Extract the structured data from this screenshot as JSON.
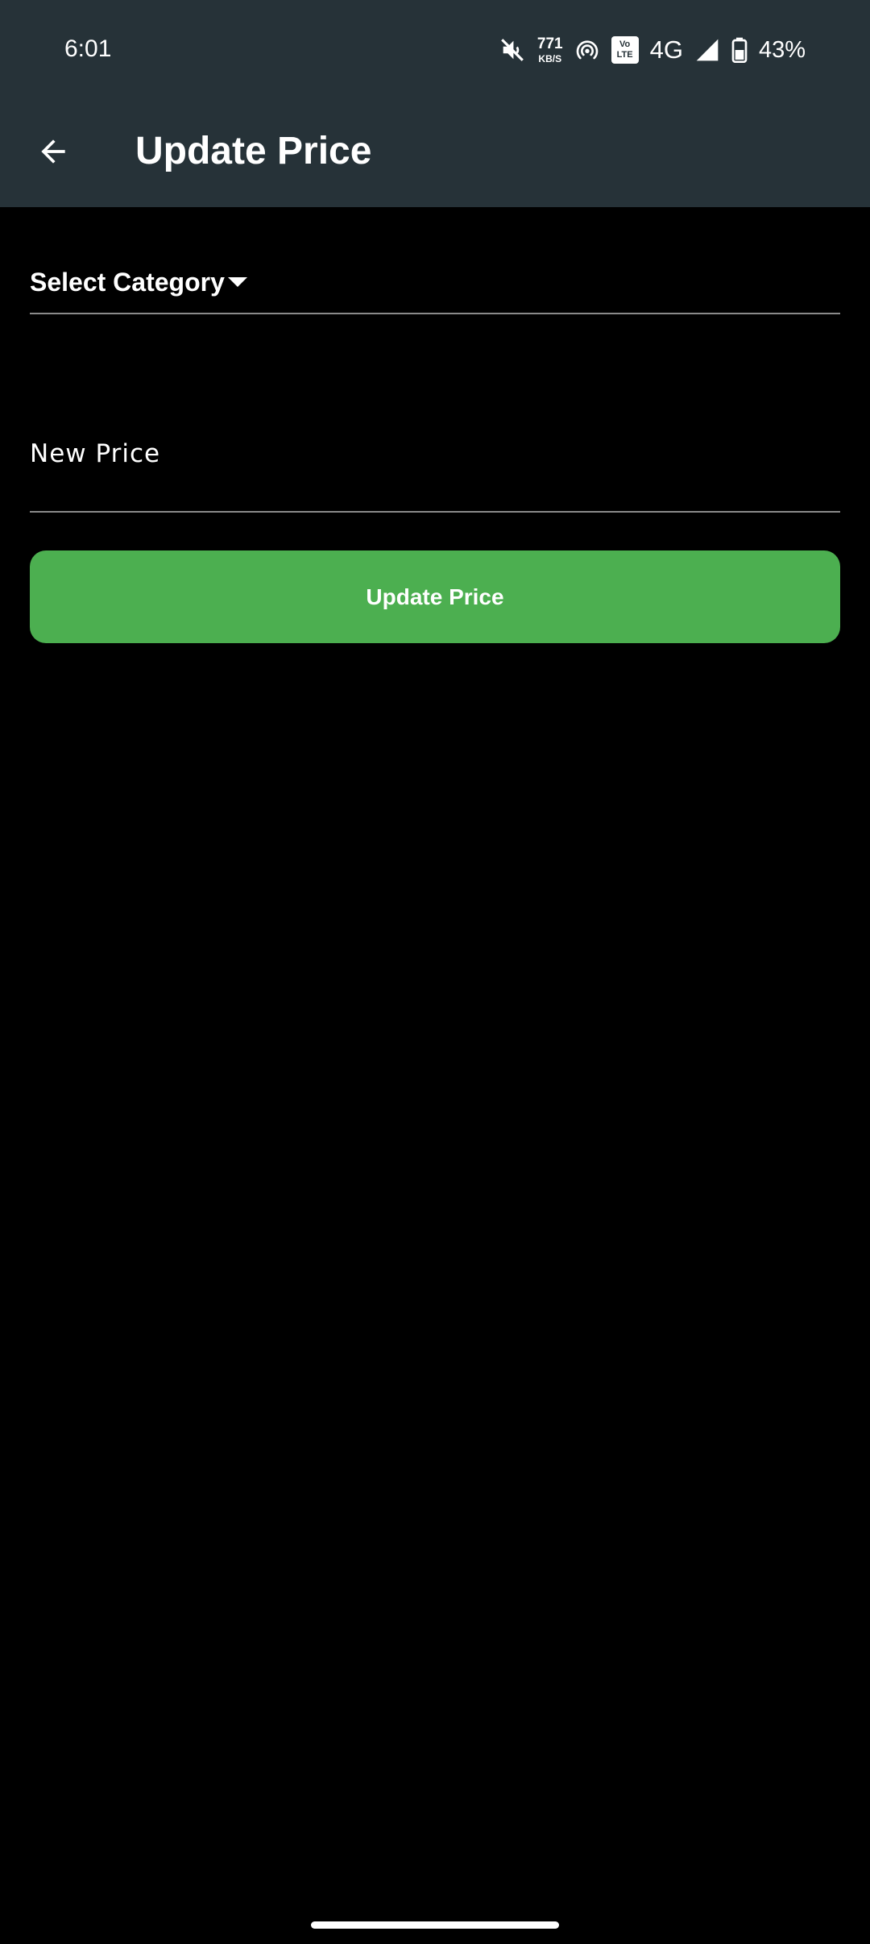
{
  "status_bar": {
    "time": "6:01",
    "speed_value": "771",
    "speed_unit": "KB/S",
    "volte_top": "Vo",
    "volte_bottom": "LTE",
    "network_type": "4G",
    "battery_percent": "43%",
    "icons": [
      "mute-icon",
      "hotspot-icon",
      "volte-icon",
      "signal-icon",
      "battery-icon"
    ]
  },
  "app_bar": {
    "title": "Update Price",
    "back_icon": "arrow-back-icon",
    "background_color": "#263238"
  },
  "form": {
    "category_label": "Select Category",
    "price_placeholder": "New Price",
    "price_value": "",
    "submit_label": "Update Price",
    "submit_color": "#4CAF50"
  }
}
